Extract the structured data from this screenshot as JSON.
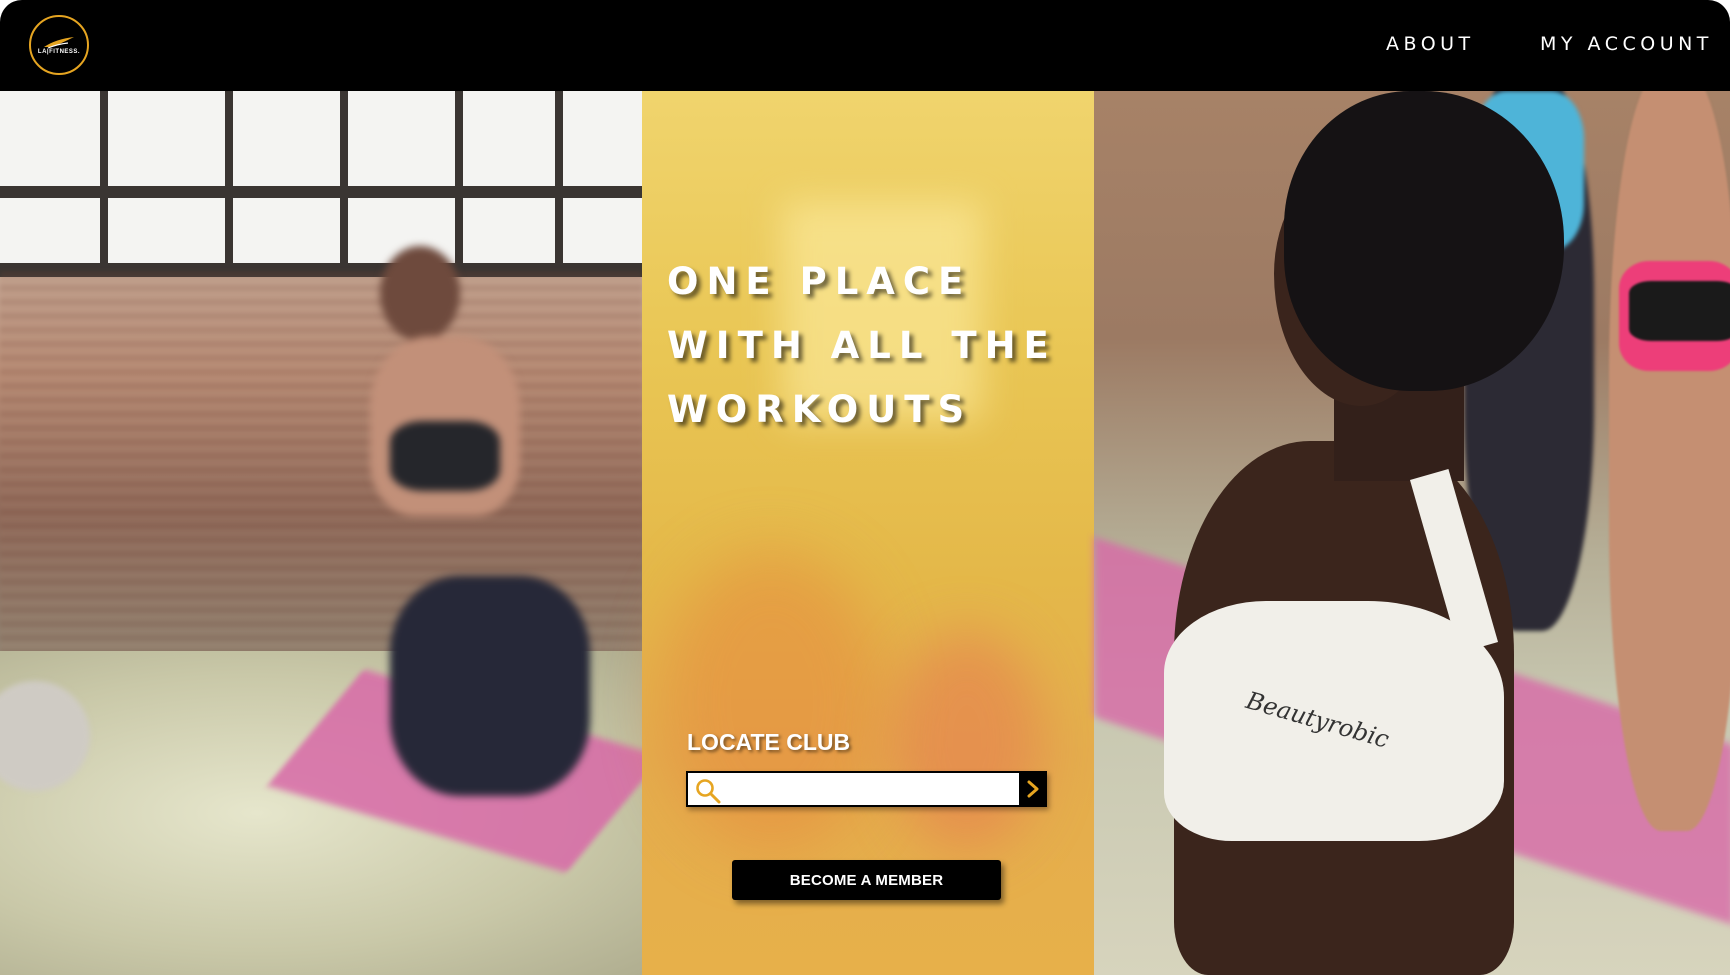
{
  "header": {
    "logo_text": "LA|FITNESS.",
    "nav": {
      "about": "ABOUT",
      "my_account": "MY ACCOUNT"
    }
  },
  "hero": {
    "headline_lines": [
      "ONE PLACE",
      "WITH ALL THE",
      "WORKOUTS"
    ],
    "locate_label": "LOCATE CLUB",
    "search": {
      "value": "",
      "placeholder": ""
    },
    "member_button": "BECOME A MEMBER",
    "bra_text": "Beautyrobic"
  },
  "colors": {
    "header_bg": "#000000",
    "accent_gold": "#e6a521",
    "panel_yellow": "#e9c654",
    "button_bg": "#000000",
    "text_light": "#ffffff"
  },
  "icons": {
    "logo": "la-fitness-logo",
    "search": "search-icon",
    "submit": "chevron-right-icon"
  }
}
